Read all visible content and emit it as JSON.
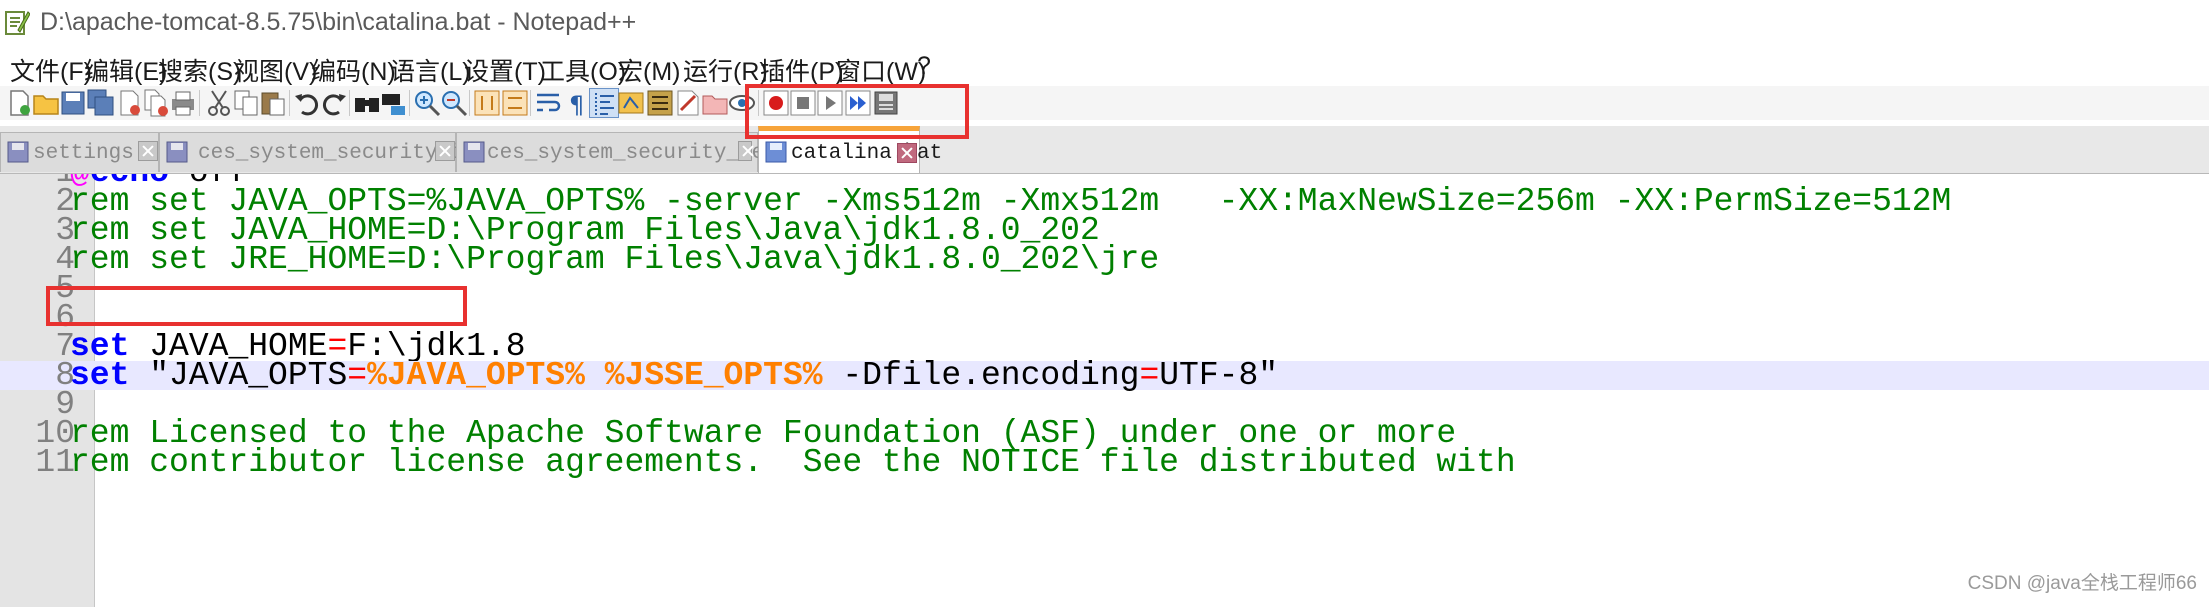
{
  "window": {
    "title": "D:\\apache-tomcat-8.5.75\\bin\\catalina.bat - Notepad++"
  },
  "menu": [
    {
      "label": "文件(F)"
    },
    {
      "label": "编辑(E)"
    },
    {
      "label": "搜索(S)"
    },
    {
      "label": "视图(V)"
    },
    {
      "label": "编码(N)"
    },
    {
      "label": "语言(L)"
    },
    {
      "label": "设置(T)"
    },
    {
      "label": "工具(O)"
    },
    {
      "label": "宏(M)"
    },
    {
      "label": "运行(R)"
    },
    {
      "label": "插件(P)"
    },
    {
      "label": "窗口(W)"
    },
    {
      "label": "?"
    }
  ],
  "toolbar_icons": [
    "new-file-icon",
    "open-file-icon",
    "save-icon",
    "save-all-icon",
    "close-icon",
    "close-all-icon",
    "print-icon",
    "cut-icon",
    "copy-icon",
    "paste-icon",
    "undo-icon",
    "redo-icon",
    "find-icon",
    "replace-icon",
    "zoom-in-icon",
    "zoom-out-icon",
    "sync-vertical-icon",
    "sync-horizontal-icon",
    "word-wrap-icon",
    "show-all-chars-icon",
    "indent-guide-icon",
    "doc-map-icon",
    "function-list-icon",
    "folder-workspace-icon",
    "monitoring-icon",
    "eye-icon",
    "record-macro-icon",
    "stop-macro-icon",
    "play-macro-icon",
    "run-macro-multiple-icon",
    "save-macro-icon"
  ],
  "tabs": [
    {
      "label": "settings.xml",
      "active": false
    },
    {
      "label": "ces_system_security_item.sql",
      "active": false
    },
    {
      "label": "ces_system_security_setup.sql",
      "active": false
    },
    {
      "label": "catalina.bat",
      "active": true
    }
  ],
  "editor": {
    "current_line": 8,
    "lines": [
      {
        "num": "1",
        "segs": [
          [
            "at",
            "@"
          ],
          [
            "kw",
            "echo"
          ],
          [
            "plain",
            " off"
          ]
        ]
      },
      {
        "num": "2",
        "segs": [
          [
            "rem",
            "rem set JAVA_OPTS=%JAVA_OPTS% -server -Xms512m -Xmx512m   -XX:MaxNewSize=256m -XX:PermSize=512M"
          ]
        ]
      },
      {
        "num": "3",
        "segs": [
          [
            "rem",
            "rem set JAVA_HOME=D:\\Program Files\\Java\\jdk1.8.0_202"
          ]
        ]
      },
      {
        "num": "4",
        "segs": [
          [
            "rem",
            "rem set JRE_HOME=D:\\Program Files\\Java\\jdk1.8.0_202\\jre"
          ]
        ]
      },
      {
        "num": "5",
        "segs": []
      },
      {
        "num": "6",
        "segs": []
      },
      {
        "num": "7",
        "segs": [
          [
            "kw",
            "set"
          ],
          [
            "plain",
            " JAVA_HOME"
          ],
          [
            "eq",
            "="
          ],
          [
            "plain",
            "F:\\jdk1.8"
          ]
        ]
      },
      {
        "num": "8",
        "segs": [
          [
            "kw",
            "set"
          ],
          [
            "plain",
            " \"JAVA_OPTS"
          ],
          [
            "eq",
            "="
          ],
          [
            "var",
            "%JAVA_OPTS%"
          ],
          [
            "plain",
            " "
          ],
          [
            "var",
            "%JSSE_OPTS%"
          ],
          [
            "plain",
            " -Dfile.encoding"
          ],
          [
            "eq",
            "="
          ],
          [
            "plain",
            "UTF-8\""
          ]
        ]
      },
      {
        "num": "9",
        "segs": []
      },
      {
        "num": "10",
        "segs": [
          [
            "rem",
            "rem Licensed to the Apache Software Foundation (ASF) under one or more"
          ]
        ]
      },
      {
        "num": "11",
        "segs": [
          [
            "rem",
            "rem contributor license agreements.  See the NOTICE file distributed with"
          ]
        ]
      }
    ]
  },
  "colors": {
    "keyword": "#0000ff",
    "comment": "#008000",
    "operator": "#ff0000",
    "variable": "#ff8000",
    "echo_off_marker": "#ff00ff",
    "current_line_bg": "#e8e8ff",
    "annotation_box": "#e8312f",
    "active_tab_accent": "#f7a43a"
  },
  "watermark": "CSDN @java全栈工程师66"
}
